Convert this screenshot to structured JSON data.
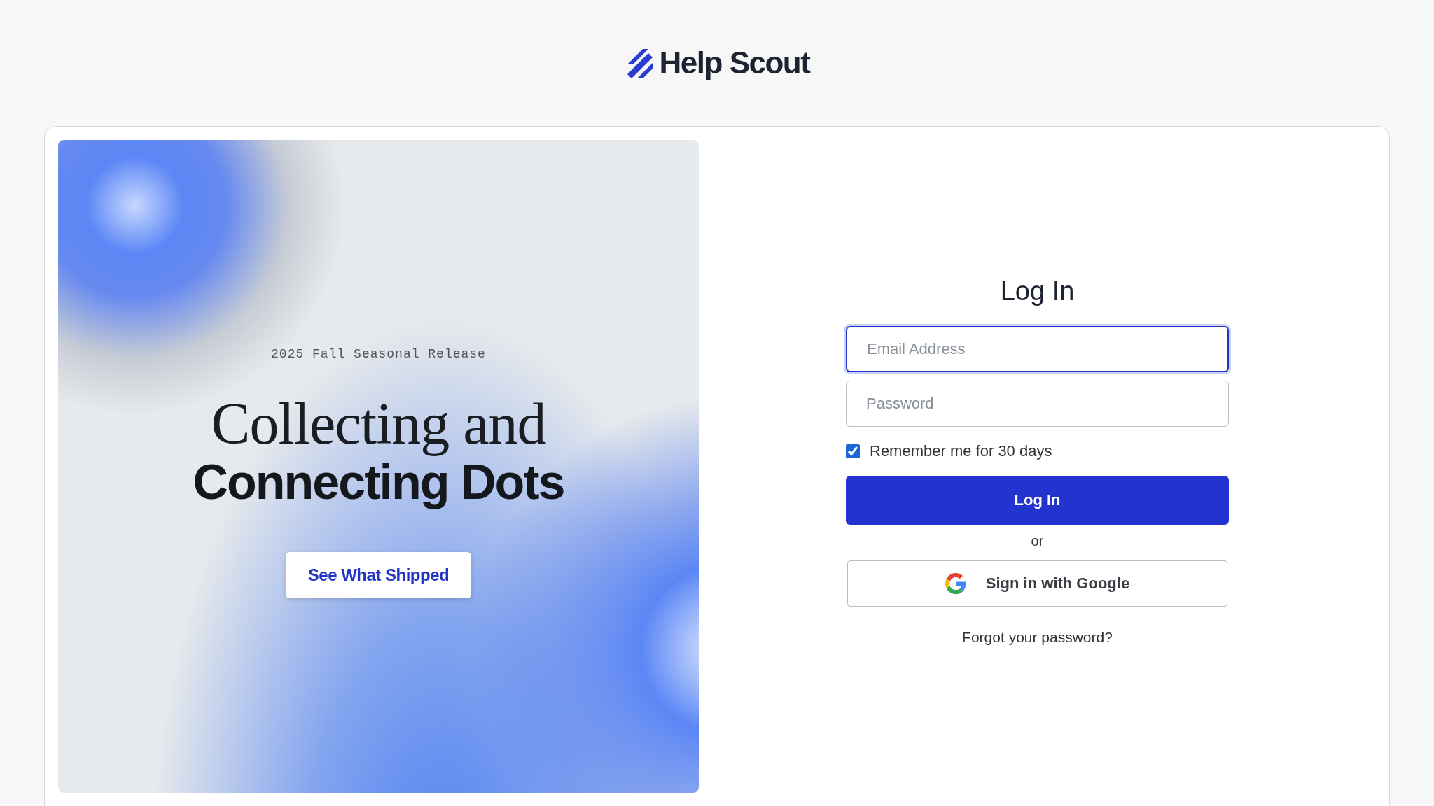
{
  "logo": {
    "text": "Help Scout"
  },
  "promo": {
    "eyebrow": "2025 Fall Seasonal Release",
    "headline_line_1": "Collecting and",
    "headline_line_2": "Connecting Dots",
    "button": "See What Shipped"
  },
  "login": {
    "title": "Log In",
    "email": {
      "placeholder": "Email Address",
      "focused": true
    },
    "password": {
      "placeholder": "Password",
      "focused": false
    },
    "remember": {
      "label": "Remember me for 30 days",
      "checked": true
    },
    "submit": "Log In",
    "separator": "or",
    "google": "Sign in with Google",
    "forgot": "Forgot your password?"
  }
}
